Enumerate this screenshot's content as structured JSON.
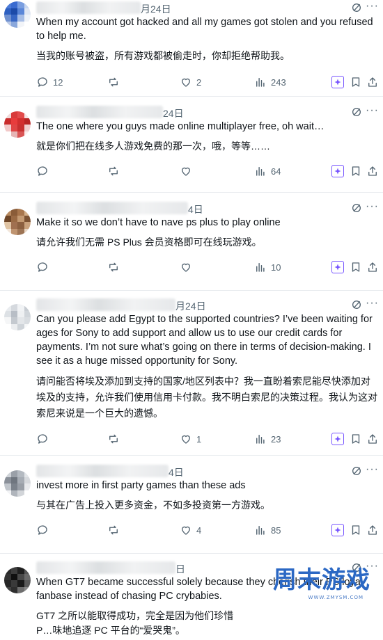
{
  "tweets": [
    {
      "date": "月24日",
      "text_en": "When my account got hacked and all my games got stolen and you refused to help me.",
      "text_zh": "当我的账号被盗，所有游戏都被偷走时，你却拒绝帮助我。",
      "replies": "12",
      "retweets": "",
      "likes": "2",
      "views": "243",
      "avatar_colors": [
        "#4c7bd8",
        "#3a6bd0",
        "#7a9ee0",
        "#c7d6f0",
        "#2d5fc0",
        "#1c4aa8",
        "#5a86d8",
        "#dfe6f3",
        "#6f90cf",
        "#3766c4",
        "#a6bde6",
        "#eef2f8",
        "#b9c8e6",
        "#8aa7db",
        "#f2f4f8",
        "#ffffff"
      ]
    },
    {
      "date": "24日",
      "text_en": "The one where you guys made online multiplayer free, oh wait…",
      "text_zh": "就是你们把在线多人游戏免费的那一次，哦，等等……",
      "replies": "",
      "retweets": "",
      "likes": "",
      "views": "64",
      "avatar_colors": [
        "#f0d9d9",
        "#d83a3a",
        "#e24b4b",
        "#f5e3e3",
        "#c92d2d",
        "#e83c3c",
        "#d22f2f",
        "#b82525",
        "#f2c9c9",
        "#e04545",
        "#c83030",
        "#f0d0d0",
        "#ffffff",
        "#e6b5b5",
        "#d95555",
        "#fbeeee"
      ]
    },
    {
      "date": "4日",
      "text_en": "Make it so we don’t have to nave ps plus to play online",
      "text_zh": "请允许我们无需 PS Plus 会员资格即可在线玩游戏。",
      "replies": "",
      "retweets": "",
      "likes": "",
      "views": "10",
      "avatar_colors": [
        "#b88a60",
        "#8a5c38",
        "#a8764c",
        "#d4b08a",
        "#6e4628",
        "#9a6a44",
        "#c49a72",
        "#7c5232",
        "#e0c4a4",
        "#a07050",
        "#8c6040",
        "#caa37e",
        "#f2e6da",
        "#bf9470",
        "#9d7454",
        "#e8d6c4"
      ]
    },
    {
      "date": "月24日",
      "text_en": "Can you please add Egypt to the supported countries? I’ve been waiting for ages for Sony to add support and allow us to use our credit cards for payments. I’m not sure what’s going on there in terms of decision-making. I see it as a huge missed opportunity for Sony.",
      "text_zh": "请问能否将埃及添加到支持的国家/地区列表中？我一直盼着索尼能尽快添加对埃及的支持，允许我们使用信用卡付款。我不明白索尼的决策过程。我认为这对索尼来说是一个巨大的遗憾。",
      "replies": "",
      "retweets": "",
      "likes": "1",
      "views": "23",
      "avatar_colors": [
        "#e9ecef",
        "#d5d9de",
        "#f1f3f5",
        "#c8cdd3",
        "#dde1e5",
        "#b8bec6",
        "#eef0f2",
        "#d0d5da",
        "#f5f6f7",
        "#c4c9cf",
        "#e3e6e9",
        "#d9dde1",
        "#ffffff",
        "#eceef0",
        "#cfd4d9",
        "#f7f8f9"
      ]
    },
    {
      "date": "4日",
      "text_en": "invest more in first party games than these ads",
      "text_zh": "与其在广告上投入更多资金，不如多投资第一方游戏。",
      "replies": "",
      "retweets": "",
      "likes": "4",
      "views": "85",
      "avatar_colors": [
        "#cfd3d8",
        "#9aa0a8",
        "#b4bac1",
        "#e2e5e8",
        "#8a9099",
        "#6f767f",
        "#a6acb4",
        "#d6d9dd",
        "#c0c5cb",
        "#7b828b",
        "#999fa7",
        "#e8eaed",
        "#f2f3f5",
        "#b0b5bc",
        "#d2d5d9",
        "#ffffff"
      ]
    },
    {
      "date": "日",
      "text_en": "When GT7 became successful solely because they cherish their PS loyal fanbase instead of chasing PC crybabies.",
      "text_zh": "GT7 之所以能取得成功，完全是因为他们珍惜 P…味地追逐 PC 平台的“爱哭鬼”。",
      "replies": "",
      "retweets": "",
      "likes": "",
      "views": "",
      "avatar_colors": [
        "#2a2a2a",
        "#3c3c3c",
        "#1f1f1f",
        "#565656",
        "#333333",
        "#101010",
        "#484848",
        "#6a6a6a",
        "#262626",
        "#3a3a3a",
        "#1a1a1a",
        "#5a5a5a",
        "#444444",
        "#2e2e2e",
        "#6e6e6e",
        "#8a8a8a"
      ]
    }
  ],
  "watermark": {
    "text": "周末游戏",
    "sub": "WWW.ZMYSM.COM",
    "color": "#2b68c4"
  }
}
